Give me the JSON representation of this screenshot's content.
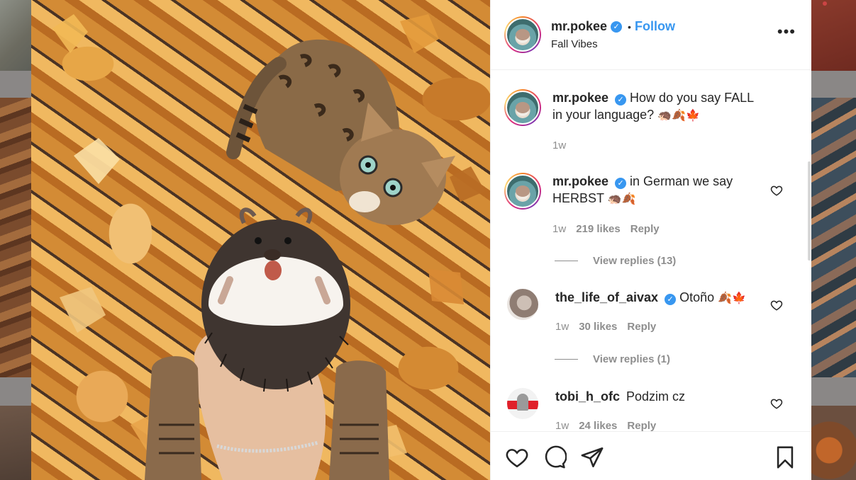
{
  "post": {
    "username": "mr.pokee",
    "follow_label": "Follow",
    "separator": "•",
    "location": "Fall Vibes",
    "more_label": "•••"
  },
  "comments": [
    {
      "username": "mr.pokee",
      "text": "How do you say FALL in your language?",
      "emoji": "🦔🍂🍁",
      "time": "1w",
      "verified": true
    },
    {
      "username": "mr.pokee",
      "text": "in German we say HERBST",
      "emoji": "🦔🍂",
      "time": "1w",
      "likes": "219 likes",
      "reply": "Reply",
      "view_replies": "View replies (13)",
      "verified": true
    },
    {
      "username": "the_life_of_aivax",
      "text": "Otoño",
      "emoji": "🍂🍁",
      "time": "1w",
      "likes": "30 likes",
      "reply": "Reply",
      "view_replies": "View replies (1)",
      "verified": true
    },
    {
      "username": "tobi_h_ofc",
      "text": "Podzim cz",
      "time": "1w",
      "likes": "24 likes",
      "reply": "Reply",
      "verified": false
    }
  ],
  "colors": {
    "accent": "#3897f0",
    "text": "#262626",
    "muted": "#8e8e8e"
  }
}
